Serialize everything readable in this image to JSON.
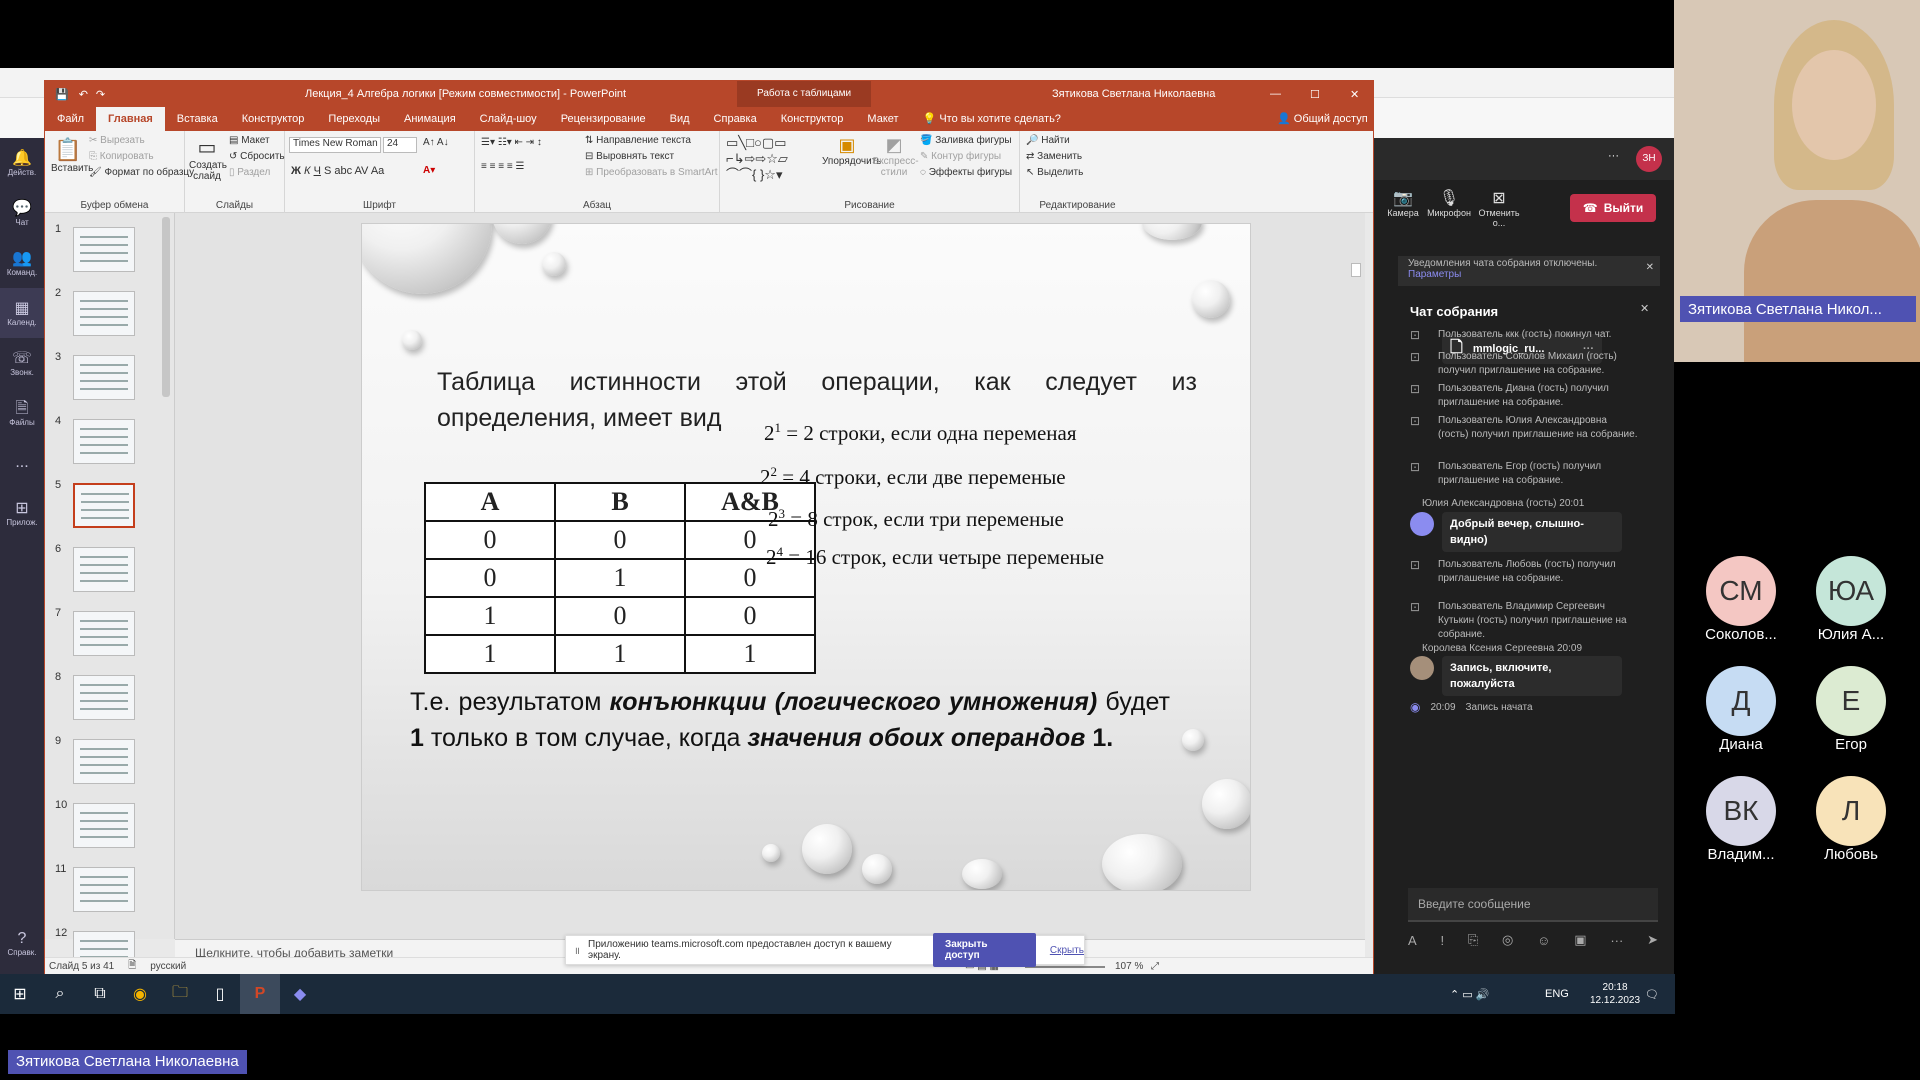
{
  "ppt": {
    "title": "Лекция_4 Алгебра логики [Режим совместимости]  -  PowerPoint",
    "context_tab": "Работа с таблицами",
    "user": "Зятикова Светлана Николаевна",
    "tabs": [
      "Файл",
      "Главная",
      "Вставка",
      "Конструктор",
      "Переходы",
      "Анимация",
      "Слайд-шоу",
      "Рецензирование",
      "Вид",
      "Справка",
      "Конструктор",
      "Макет"
    ],
    "tell_me": "Что вы хотите сделать?",
    "share": "Общий доступ",
    "ribbon": {
      "paste": "Вставить",
      "cut": "Вырезать",
      "copy": "Копировать",
      "format_painter": "Формат по образцу",
      "clipboard_label": "Буфер обмена",
      "new_slide": "Создать слайд",
      "layout": "Макет",
      "reset": "Сбросить",
      "section": "Раздел",
      "slides_label": "Слайды",
      "font_name": "Times New Roman",
      "font_size": "24",
      "font_label": "Шрифт",
      "text_direction": "Направление текста",
      "align_text": "Выровнять текст",
      "smartart": "Преобразовать в SmartArt",
      "paragraph_label": "Абзац",
      "arrange": "Упорядочить",
      "quick_styles": "Экспресс-стили",
      "shape_fill": "Заливка фигуры",
      "shape_outline": "Контур фигуры",
      "shape_effects": "Эффекты фигуры",
      "drawing_label": "Рисование",
      "find": "Найти",
      "replace": "Заменить",
      "select": "Выделить",
      "editing_label": "Редактирование"
    },
    "thumb_numbers": [
      "1",
      "2",
      "3",
      "4",
      "5",
      "6",
      "7",
      "8",
      "9",
      "10",
      "11",
      "12"
    ],
    "notes_placeholder": "Щелкните, чтобы добавить заметки",
    "status_slide": "Слайд 5 из 41",
    "status_lang": "русский",
    "zoom": "107 %"
  },
  "slide": {
    "intro": "Таблица истинности этой операции, как следует из определения, имеет вид",
    "table_headers": [
      "A",
      "B",
      "A&B"
    ],
    "table_rows": [
      [
        "0",
        "0",
        "0"
      ],
      [
        "0",
        "1",
        "0"
      ],
      [
        "1",
        "0",
        "0"
      ],
      [
        "1",
        "1",
        "1"
      ]
    ],
    "formulas": [
      {
        "base": "2",
        "exp": "1",
        "text": " = 2 строки, если одна переменая"
      },
      {
        "base": "2",
        "exp": "2",
        "text": " = 4 строки, если две переменые"
      },
      {
        "base": "2",
        "exp": "3",
        "text": " = 8 строк, если три переменые"
      },
      {
        "base": "2",
        "exp": "4",
        "text": " = 16 строк, если четыре переменые"
      }
    ],
    "conclusion_1": "Т.е. результатом ",
    "conclusion_bold_1": "конъюнкции (логического умножения)",
    "conclusion_2": " будет ",
    "conclusion_num": "1",
    "conclusion_3": " только в том случае, когда ",
    "conclusion_bold_2": "значения обоих операндов",
    "conclusion_4": " 1."
  },
  "share_banner": {
    "text": "Приложению teams.microsoft.com предоставлен доступ к вашему экрану.",
    "stop": "Закрыть доступ",
    "hide": "Скрыть"
  },
  "teams": {
    "rail": [
      "Действ.",
      "Чат",
      "Команд.",
      "Календ.",
      "Звонк.",
      "Файлы",
      "...",
      "Прилож.",
      "Справк."
    ],
    "camera": "Камера",
    "mic": "Микрофон",
    "share_stop": "Отменить о...",
    "leave": "Выйти",
    "notice": "Уведомления чата собрания отключены.",
    "notice_link": "Параметры",
    "chat_title": "Чат собрания",
    "file_name": "mmlogic_ru...",
    "messages": [
      "Пользователь ккк (гость) покинул чат.",
      "Пользователь Соколов Михаил (гость) получил приглашение на собрание.",
      "Пользователь Диана (гость) получил приглашение на собрание.",
      "Пользователь Юлия Александровна (гость) получил приглашение на собрание.",
      "Пользователь Егор (гость) получил приглашение на собрание."
    ],
    "author1": "Юлия Александровна (гость)   20:01",
    "bubble1": "Добрый вечер, слышно-видно)",
    "messages2": [
      "Пользователь Любовь (гость) получил приглашение на собрание.",
      "Пользователь Владимир Сергеевич Кутькин (гость) получил приглашение на собрание."
    ],
    "author2": "Королева Ксения Сергеевна   20:09",
    "bubble2": "Запись, включите, пожалуйста",
    "recording_time": "20:09",
    "recording": "Запись начата",
    "input_placeholder": "Введите сообщение"
  },
  "video": {
    "name": "Зятикова Светлана Никол..."
  },
  "participants": [
    {
      "initials": "СМ",
      "name": "Соколов...",
      "color": "#f4c7c3"
    },
    {
      "initials": "ЮА",
      "name": "Юлия А...",
      "color": "#c5e6d9"
    },
    {
      "initials": "Д",
      "name": "Диана",
      "color": "#c6dcf3"
    },
    {
      "initials": "Е",
      "name": "Егор",
      "color": "#dcebd2"
    },
    {
      "initials": "ВК",
      "name": "Владим...",
      "color": "#d8d8e8"
    },
    {
      "initials": "Л",
      "name": "Любовь",
      "color": "#f8e3b9"
    }
  ],
  "taskbar": {
    "lang": "ENG",
    "time": "20:18",
    "date": "12.12.2023"
  },
  "presenter": "Зятикова Светлана Николаевна"
}
